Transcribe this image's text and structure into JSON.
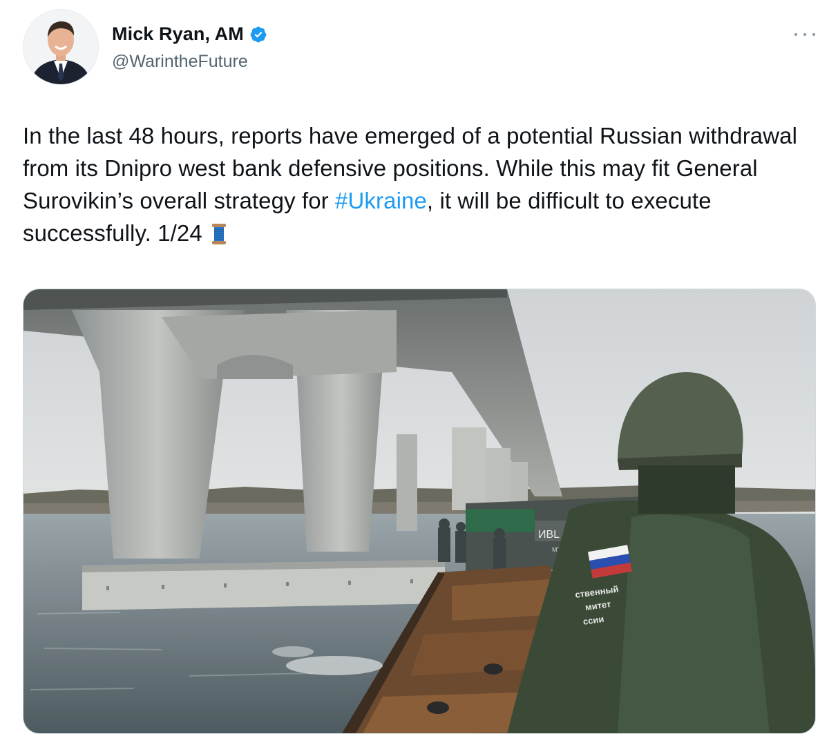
{
  "tweet": {
    "author": {
      "display_name": "Mick Ryan, AM",
      "handle": "@WarintheFuture",
      "verified": true
    },
    "text": {
      "part1": "In the last 48 hours, reports have emerged of a potential Russian withdrawal from its Dnipro west bank defensive positions. While this may fit General Surovikin’s overall strategy for ",
      "hashtag": "#Ukraine",
      "part2": ", it will be difficult to execute successfully. 1/24 "
    },
    "media": {
      "patch_text": [
        "ственный",
        "митет",
        "ссии"
      ],
      "boat_marking": "ИВL — ",
      "boat_marking_small": "МТ Ш"
    }
  },
  "colors": {
    "link": "#1d9bf0",
    "verified": "#1d9bf0",
    "secondary_text": "#536471",
    "primary_text": "#0f1419"
  },
  "icons": {
    "verified": "verified-badge-icon",
    "more": "more-dots-icon",
    "thread": "spool-of-thread-icon"
  }
}
